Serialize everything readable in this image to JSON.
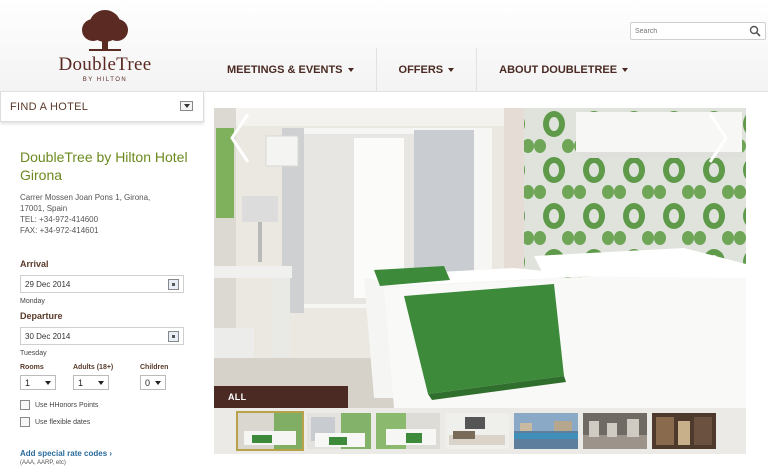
{
  "brand": {
    "name": "DoubleTree",
    "sub": "BY HILTON"
  },
  "search": {
    "placeholder": "Search"
  },
  "nav": [
    {
      "label": "MEETINGS & EVENTS"
    },
    {
      "label": "OFFERS"
    },
    {
      "label": "ABOUT DOUBLETREE"
    }
  ],
  "find_hotel": {
    "label": "FIND A HOTEL"
  },
  "hotel": {
    "name": "DoubleTree by Hilton Hotel Girona",
    "address_line1": "Carrer Mossen Joan Pons 1, Girona,",
    "address_line2": "17001, Spain",
    "tel": "TEL: +34-972-414600",
    "fax": "FAX: +34-972-414601"
  },
  "booking": {
    "arrival_label": "Arrival",
    "arrival_date": "29 Dec 2014",
    "arrival_day": "Monday",
    "departure_label": "Departure",
    "departure_date": "30 Dec 2014",
    "departure_day": "Tuesday",
    "rooms_label": "Rooms",
    "rooms_value": "1",
    "adults_label": "Adults  (18+)",
    "adults_value": "1",
    "children_label": "Children",
    "children_value": "0",
    "hhonors_label": "Use HHonors Points",
    "flexible_label": "Use flexible dates",
    "special_rates_label": "Add special rate codes ›",
    "special_rates_sub": "(AAA, AARP, etc)"
  },
  "gallery": {
    "album_label": "ALL",
    "thumb_count": 7,
    "active_thumb": 0
  },
  "colors": {
    "brand": "#5a2a23",
    "hotel_name": "#6b8a1e",
    "link": "#2b6b9a",
    "album_bar": "#4a2a22",
    "throw_green": "#3c8a3a"
  },
  "icons": [
    "tree-logo-icon",
    "search-icon",
    "chevron-down-icon",
    "calendar-icon",
    "prev-arrow-icon",
    "next-arrow-icon"
  ]
}
